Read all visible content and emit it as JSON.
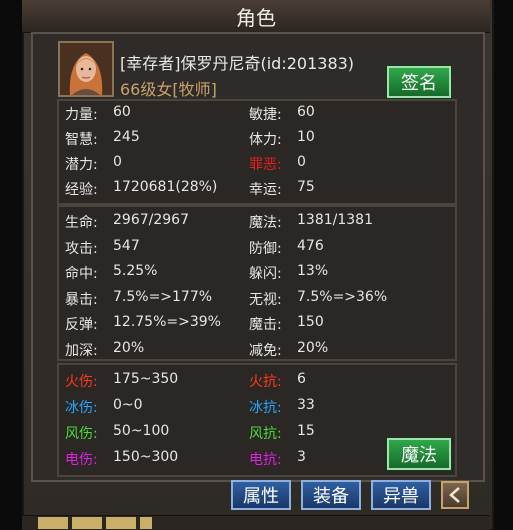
{
  "title": "角色",
  "profile": {
    "name": "[幸存者]保罗丹尼奇(id:201383)",
    "level_class": "66级女[牧师]",
    "sign_button": "签名"
  },
  "colors": {
    "fire": "#ff3a1a",
    "ice": "#27a7ff",
    "wind": "#4fda3a",
    "electric": "#e020e0",
    "evil": "#e02020",
    "default": "#e6e6e6"
  },
  "basic": [
    {
      "l1": "力量:",
      "v1": "60",
      "l2": "敏捷:",
      "v2": "60"
    },
    {
      "l1": "智慧:",
      "v1": "245",
      "l2": "体力:",
      "v2": "10"
    },
    {
      "l1": "潜力:",
      "v1": "0",
      "l2": "罪恶:",
      "v2": "0"
    },
    {
      "l1": "经验:",
      "v1": "1720681(28%)",
      "l2": "幸运:",
      "v2": "75"
    }
  ],
  "combat": [
    {
      "l1": "生命:",
      "v1": "2967/2967",
      "l2": "魔法:",
      "v2": "1381/1381"
    },
    {
      "l1": "攻击:",
      "v1": "547",
      "l2": "防御:",
      "v2": "476"
    },
    {
      "l1": "命中:",
      "v1": "5.25%",
      "l2": "躲闪:",
      "v2": "13%"
    },
    {
      "l1": "暴击:",
      "v1": "7.5%=>177%",
      "l2": "无视:",
      "v2": "7.5%=>36%"
    },
    {
      "l1": "反弹:",
      "v1": "12.75%=>39%",
      "l2": "魔击:",
      "v2": "150"
    },
    {
      "l1": "加深:",
      "v1": "20%",
      "l2": "减免:",
      "v2": "20%"
    }
  ],
  "elements": [
    {
      "l1": "火伤:",
      "v1": "175~350",
      "l2": "火抗:",
      "v2": "6"
    },
    {
      "l1": "冰伤:",
      "v1": "0~0",
      "l2": "冰抗:",
      "v2": "33"
    },
    {
      "l1": "风伤:",
      "v1": "50~100",
      "l2": "风抗:",
      "v2": "15"
    },
    {
      "l1": "电伤:",
      "v1": "150~300",
      "l2": "电抗:",
      "v2": "3"
    }
  ],
  "magic_button": "魔法",
  "tabs": [
    "属性",
    "装备",
    "异兽"
  ]
}
